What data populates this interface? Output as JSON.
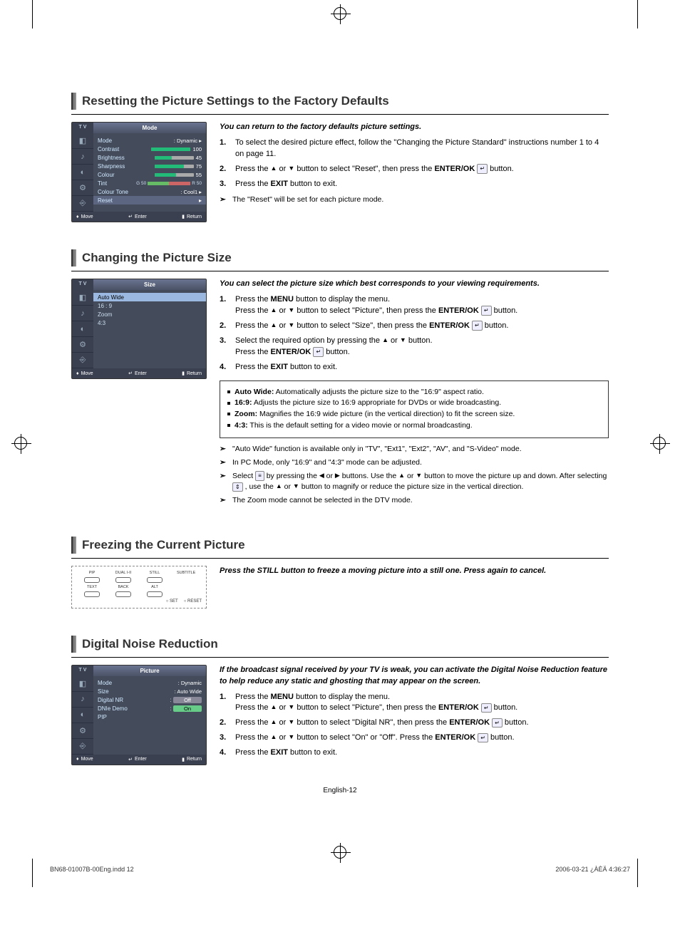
{
  "sections": {
    "reset": {
      "title": "Resetting the Picture Settings to the Factory Defaults",
      "intro": "You can return to the factory defaults picture settings.",
      "steps": [
        "To select the desired picture effect, follow the \"Changing the Picture Standard\" instructions number 1 to 4 on page 11.",
        "Press the ▲ or ▼ button to select \"Reset\", then press the ENTER/OK ↵ button.",
        "Press the EXIT button to exit."
      ],
      "note": "The \"Reset\" will be set for each picture mode.",
      "osd": {
        "corner": "T V",
        "tab": "Mode",
        "rows": {
          "mode_label": "Mode",
          "mode_val": ": Dynamic",
          "contrast": "Contrast",
          "contrast_val": "100",
          "brightness": "Brightness",
          "brightness_val": "45",
          "sharpness": "Sharpness",
          "sharpness_val": "75",
          "colour": "Colour",
          "colour_val": "55",
          "tint": "Tint",
          "tint_g": "G 50",
          "tint_r": "R 50",
          "ctone": "Colour Tone",
          "ctone_val": ": Cool1",
          "reset": "Reset"
        },
        "foot": {
          "move": "Move",
          "enter": "Enter",
          "ret": "Return"
        }
      }
    },
    "size": {
      "title": "Changing the Picture Size",
      "intro": "You can select the picture size which best corresponds to your viewing requirements.",
      "steps": [
        "Press the MENU button to display the menu. Press the ▲ or ▼ button to select \"Picture\", then press the ENTER/OK ↵ button.",
        "Press the ▲ or ▼ button to select \"Size\", then press the ENTER/OK ↵ button.",
        "Select the required option by pressing the ▲ or ▼ button. Press the ENTER/OK ↵ button.",
        "Press the EXIT button to exit."
      ],
      "box": {
        "auto_wide": "Auto Wide: Automatically adjusts the picture size to the \"16:9\" aspect ratio.",
        "r169": "16:9: Adjusts the picture size to 16:9 appropriate for DVDs or wide broadcasting.",
        "zoom": "Zoom: Magnifies the 16:9 wide picture (in the vertical direction) to fit the screen size.",
        "r43": "4:3: This is the default setting for a video movie or normal broadcasting."
      },
      "notes": [
        "\"Auto Wide\" function is available only in \"TV\", \"Ext1\", \"Ext2\", \"AV\", and \"S-Video\" mode.",
        "In PC Mode, only \"16:9\" and \"4:3\" mode can be adjusted.",
        "Select ☐ by pressing the ◀ or ▶ buttons. Use the ▲ or ▼ button to move the picture up and down.  After selecting ☐ , use the ▲ or ▼ button to magnify or reduce the picture size in the vertical direction.",
        "The Zoom mode cannot be selected in the DTV mode."
      ],
      "osd": {
        "corner": "T V",
        "tab": "Size",
        "items": [
          "Auto Wide",
          "16 : 9",
          "Zoom",
          "4:3"
        ],
        "foot": {
          "move": "Move",
          "enter": "Enter",
          "ret": "Return"
        }
      }
    },
    "freeze": {
      "title": "Freezing the Current Picture",
      "intro": "Press the STILL button to freeze a moving picture into a still one. Press again to cancel.",
      "remote": {
        "top": [
          "PIP",
          "DUAL I-II",
          "STILL",
          "SUBTITLE"
        ],
        "mid": [
          "TEXT",
          "BACK",
          "ALT"
        ],
        "bottom": [
          "SET",
          "RESET"
        ]
      }
    },
    "dnr": {
      "title": "Digital Noise Reduction",
      "intro": "If the broadcast signal received by your TV is weak, you can activate the Digital Noise Reduction feature to help reduce any static and ghosting that may appear on the screen.",
      "steps": [
        "Press the MENU button to display the menu. Press the ▲ or ▼ button to select \"Picture\", then press the ENTER/OK ↵ button.",
        "Press the ▲ or ▼ button to select \"Digital NR\", then press the ENTER/OK ↵ button.",
        "Press the ▲ or ▼ button to select \"On\" or \"Off\". Press the ENTER/OK ↵ button.",
        "Press the EXIT button to exit."
      ],
      "osd": {
        "corner": "T V",
        "tab": "Picture",
        "rows": {
          "mode": "Mode",
          "mode_val": ": Dynamic",
          "size": "Size",
          "size_val": ": Auto Wide",
          "dnr": "Digital NR",
          "dnr_val": "Off",
          "dnie": "DNIe Demo",
          "dnie_val": "On",
          "pip": "PIP"
        },
        "foot": {
          "move": "Move",
          "enter": "Enter",
          "ret": "Return"
        }
      }
    }
  },
  "keywords": {
    "menu": "MENU",
    "enterok": "ENTER/OK",
    "exit": "EXIT"
  },
  "footer": {
    "left": "BN68-01007B-00Eng.indd   12",
    "right": "2006-03-21   ¿ÀÈÄ 4:36:27",
    "pagenum": "English-12"
  }
}
